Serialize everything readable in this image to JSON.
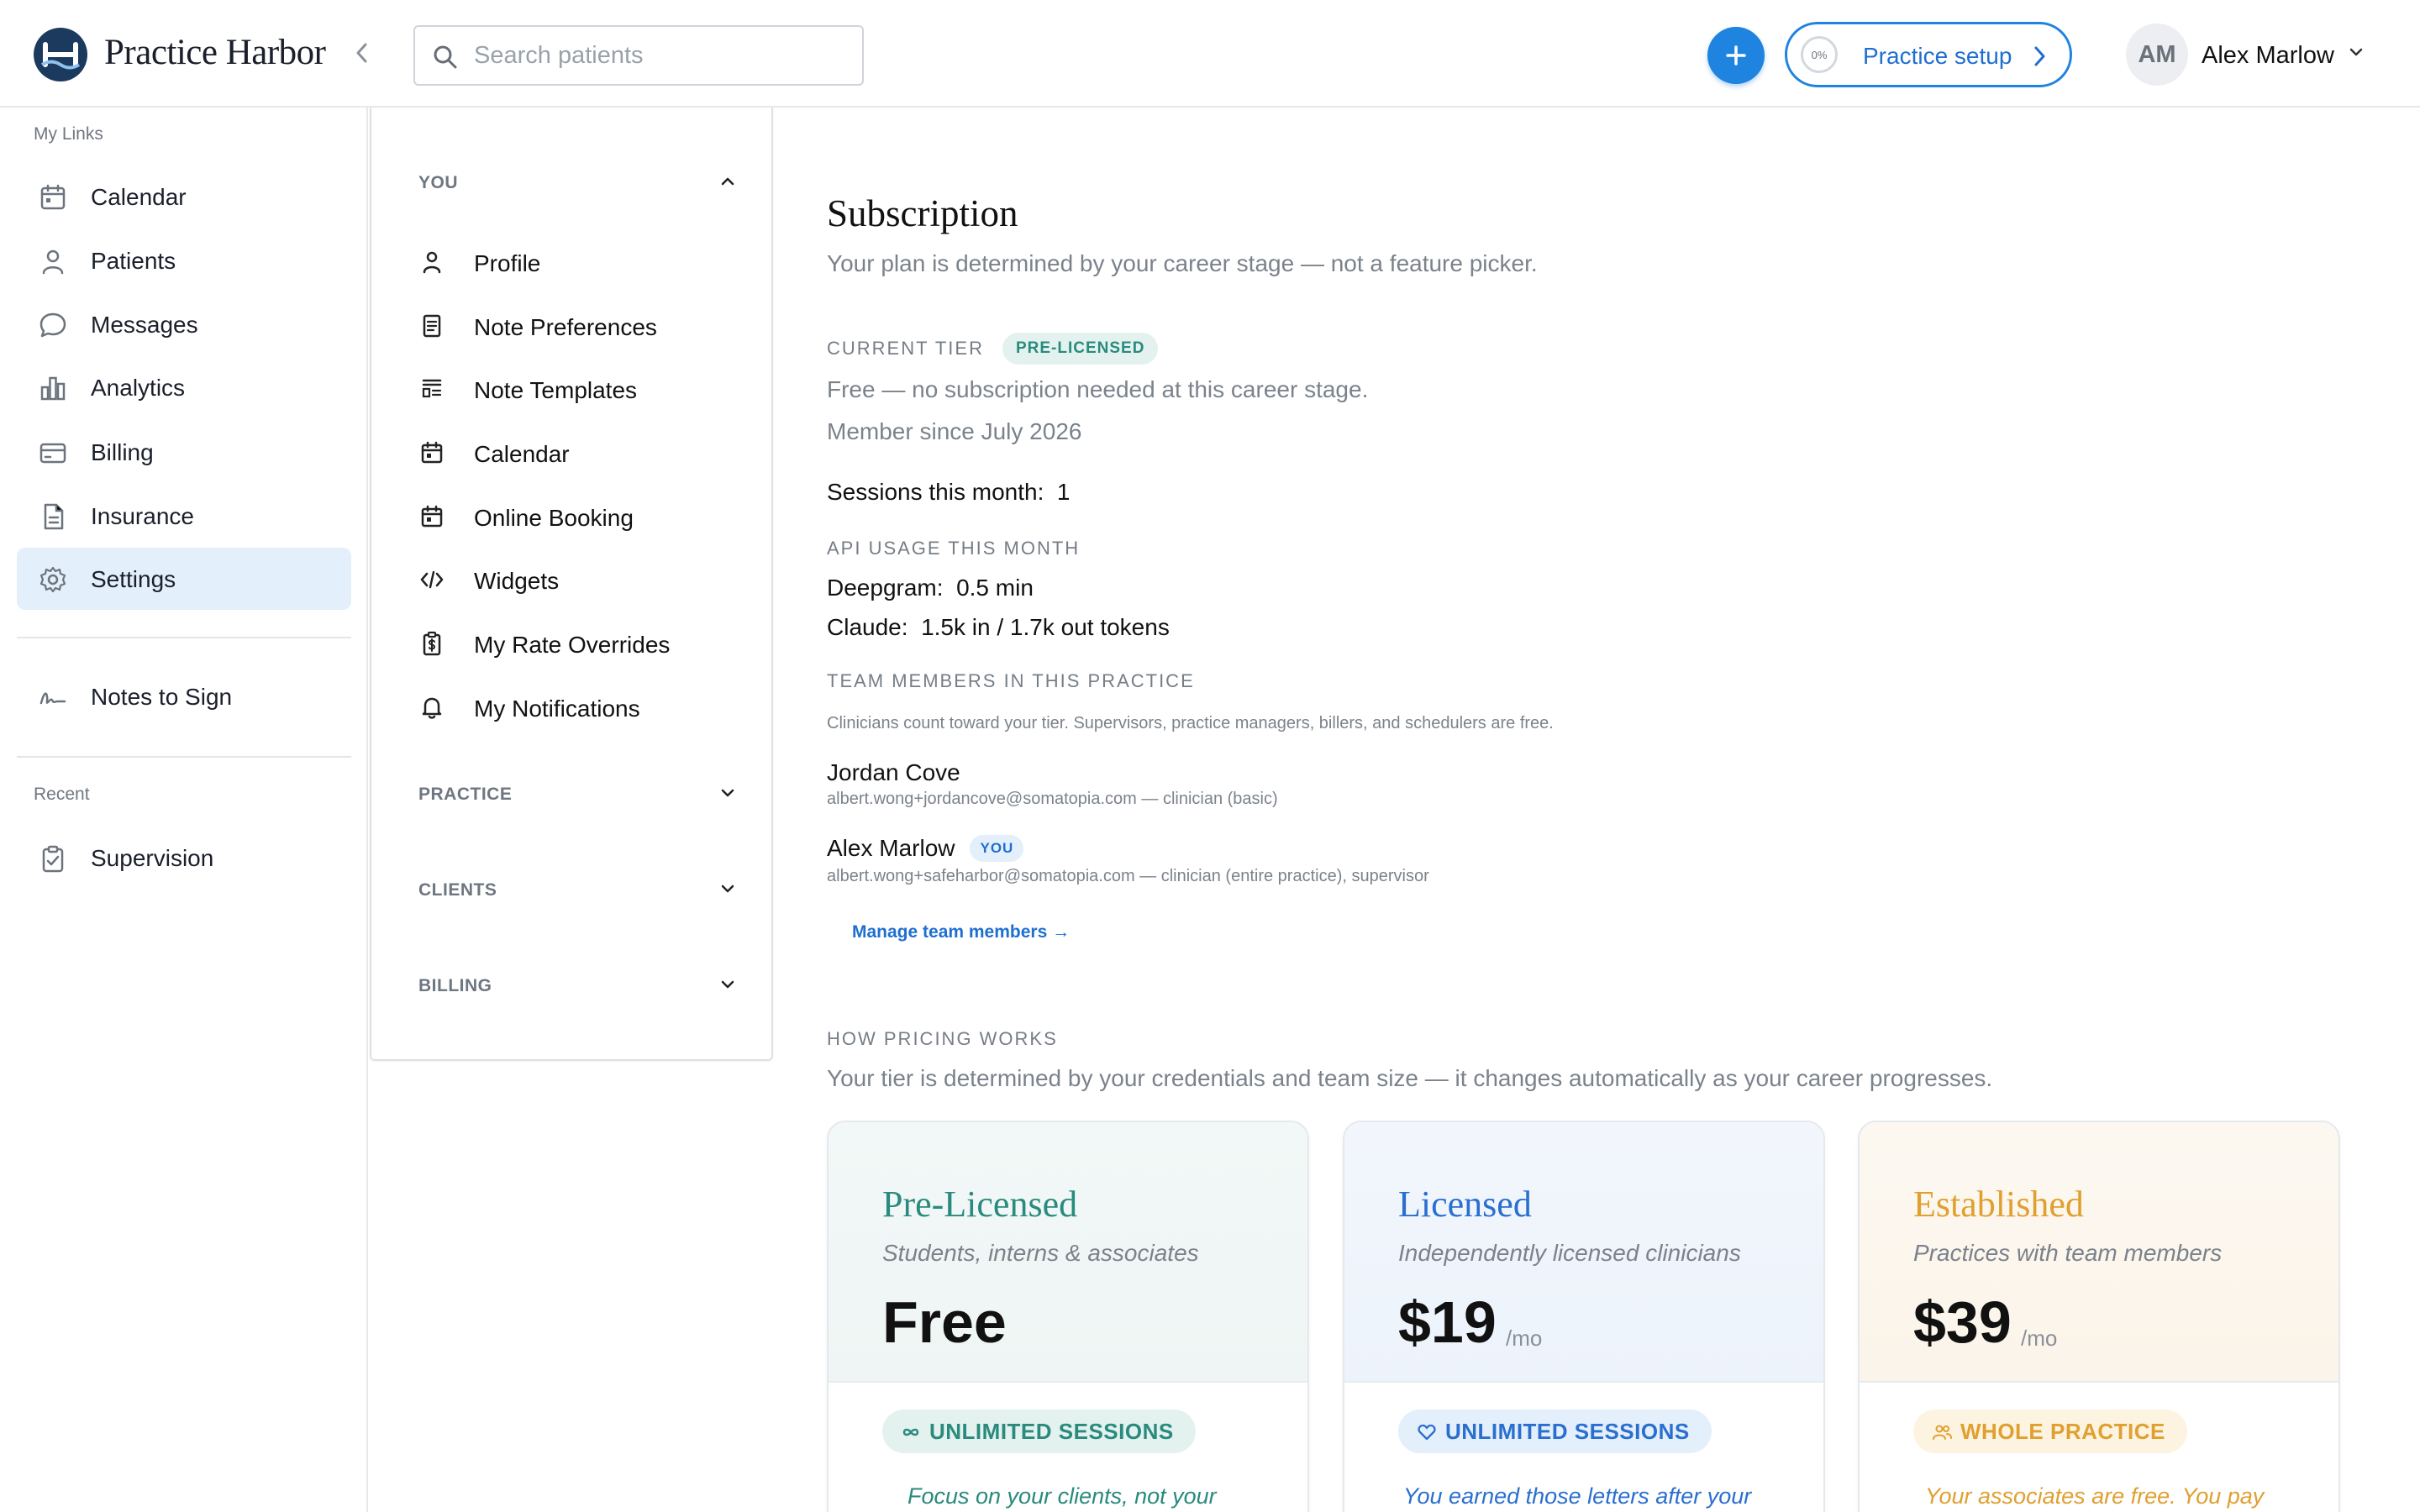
{
  "app": {
    "title": "Practice Harbor"
  },
  "search": {
    "placeholder": "Search patients"
  },
  "setup": {
    "percent": "0%",
    "label": "Practice setup"
  },
  "user": {
    "initials": "AM",
    "name": "Alex Marlow"
  },
  "sidebar": {
    "my_links_label": "My Links",
    "items": [
      {
        "label": "Calendar",
        "icon": "calendar-icon"
      },
      {
        "label": "Patients",
        "icon": "person-icon"
      },
      {
        "label": "Messages",
        "icon": "chat-bubble-icon"
      },
      {
        "label": "Analytics",
        "icon": "bar-chart-icon"
      },
      {
        "label": "Billing",
        "icon": "credit-card-icon"
      },
      {
        "label": "Insurance",
        "icon": "document-icon"
      },
      {
        "label": "Settings",
        "icon": "gear-icon",
        "active": true
      }
    ],
    "notes_to_sign": "Notes to Sign",
    "recent_label": "Recent",
    "recent_items": [
      {
        "label": "Supervision",
        "icon": "clipboard-check-icon"
      }
    ]
  },
  "settings_menu": {
    "you_label": "YOU",
    "you_items": [
      {
        "label": "Profile",
        "icon": "person-icon"
      },
      {
        "label": "Note Preferences",
        "icon": "notes-icon"
      },
      {
        "label": "Note Templates",
        "icon": "template-icon"
      },
      {
        "label": "Calendar",
        "icon": "calendar-icon"
      },
      {
        "label": "Online Booking",
        "icon": "calendar-icon"
      },
      {
        "label": "Widgets",
        "icon": "code-icon"
      },
      {
        "label": "My Rate Overrides",
        "icon": "clipboard-dollar-icon"
      },
      {
        "label": "My Notifications",
        "icon": "bell-icon"
      }
    ],
    "practice_label": "PRACTICE",
    "clients_label": "CLIENTS",
    "billing_label": "BILLING"
  },
  "subscription": {
    "title": "Subscription",
    "subtitle": "Your plan is determined by your career stage — not a feature picker.",
    "current_tier_label": "CURRENT TIER",
    "current_tier_badge": "PRE-LICENSED",
    "tier_desc": "Free — no subscription needed at this career stage.",
    "member_since": "Member since July 2026",
    "sessions_label": "Sessions this month:",
    "sessions_value": "1",
    "api_label": "API USAGE THIS MONTH",
    "deepgram_label": "Deepgram:",
    "deepgram_value": "0.5 min",
    "claude_label": "Claude:",
    "claude_value": "1.5k in / 1.7k out tokens",
    "team_label": "TEAM MEMBERS IN THIS PRACTICE",
    "team_note": "Clinicians count toward your tier. Supervisors, practice managers, billers, and schedulers are free.",
    "members": [
      {
        "name": "Jordan Cove",
        "detail": "albert.wong+jordancove@somatopia.com — clinician (basic)",
        "you": false
      },
      {
        "name": "Alex Marlow",
        "detail": "albert.wong+safeharbor@somatopia.com — clinician (entire practice), supervisor",
        "you": true,
        "you_badge": "YOU"
      }
    ],
    "manage_link": "Manage team members →"
  },
  "pricing": {
    "label": "HOW PRICING WORKS",
    "desc": "Your tier is determined by your credentials and team size — it changes automatically as your career progresses.",
    "tiers": [
      {
        "name": "Pre-Licensed",
        "sub": "Students, interns & associates",
        "price": "Free",
        "per": "",
        "badge": "UNLIMITED SESSIONS",
        "badge_icon": "infinity-icon",
        "blurb": "Focus on your clients, not your",
        "color": "#2a8a7d",
        "badge_bg": "#e3f2ef"
      },
      {
        "name": "Licensed",
        "sub": "Independently licensed clinicians",
        "price": "$19",
        "per": "/mo",
        "badge": "UNLIMITED SESSIONS",
        "badge_icon": "heart-icon",
        "blurb": "You earned those letters after your",
        "color": "#2a6fd0",
        "badge_bg": "#e3effa"
      },
      {
        "name": "Established",
        "sub": "Practices with team members",
        "price": "$39",
        "per": "/mo",
        "badge": "WHOLE PRACTICE",
        "badge_icon": "users-icon",
        "blurb": "Your associates are free. You pay",
        "color": "#e0a030",
        "badge_bg": "#fdf3e1"
      }
    ]
  }
}
